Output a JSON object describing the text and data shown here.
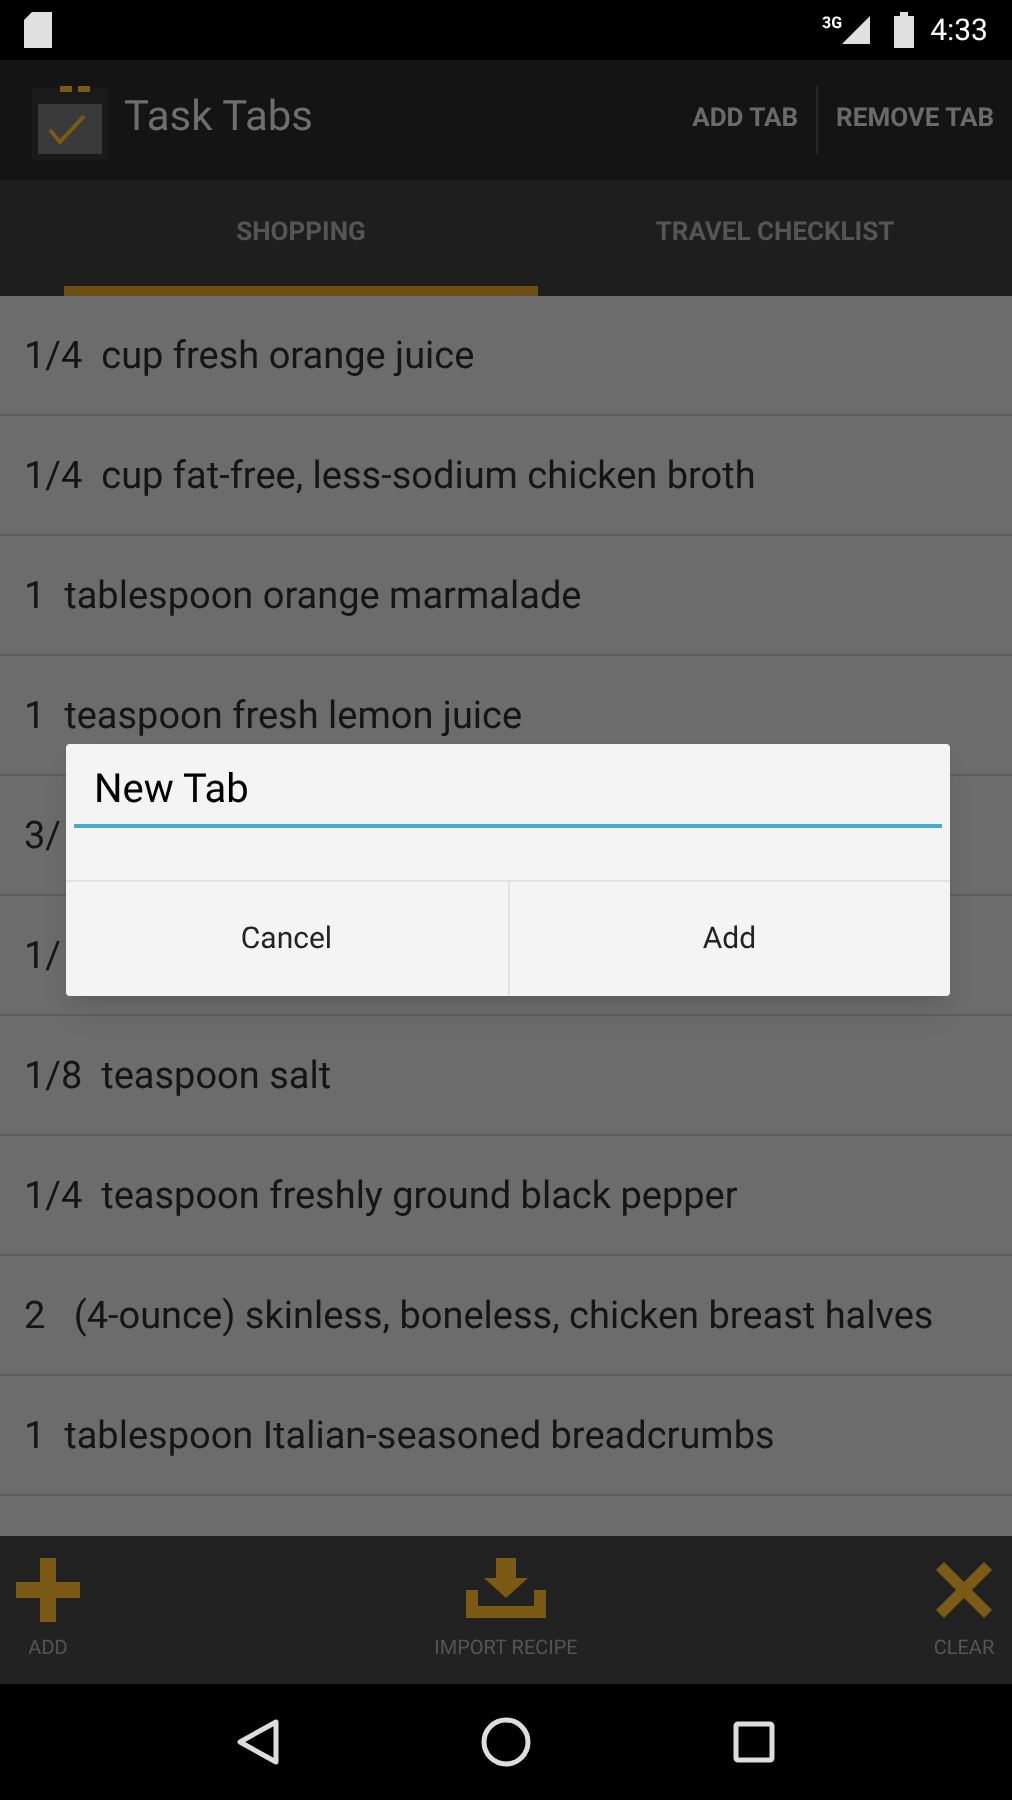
{
  "status_bar": {
    "time": "4:33",
    "network": "3G"
  },
  "app_bar": {
    "title": "Task Tabs",
    "actions": [
      "ADD TAB",
      "REMOVE TAB"
    ]
  },
  "tabs": [
    {
      "label": "SHOPPING",
      "selected": true
    },
    {
      "label": "TRAVEL CHECKLIST",
      "selected": false
    }
  ],
  "items": [
    "1/4  cup fresh orange juice",
    "1/4  cup fat-free, less-sodium chicken broth",
    "1  tablespoon orange marmalade",
    "1  teaspoon fresh lemon juice",
    "3/",
    "1/",
    "1/8  teaspoon salt",
    "1/4  teaspoon freshly ground black pepper",
    "2   (4-ounce) skinless, boneless, chicken breast halves",
    "1  tablespoon Italian-seasoned breadcrumbs"
  ],
  "dialog": {
    "value": "New Tab",
    "buttons": [
      "Cancel",
      "Add"
    ]
  },
  "bottom_bar": [
    {
      "kind": "add",
      "label": "ADD"
    },
    {
      "kind": "import",
      "label": "IMPORT RECIPE"
    },
    {
      "kind": "clear",
      "label": "CLEAR"
    }
  ]
}
